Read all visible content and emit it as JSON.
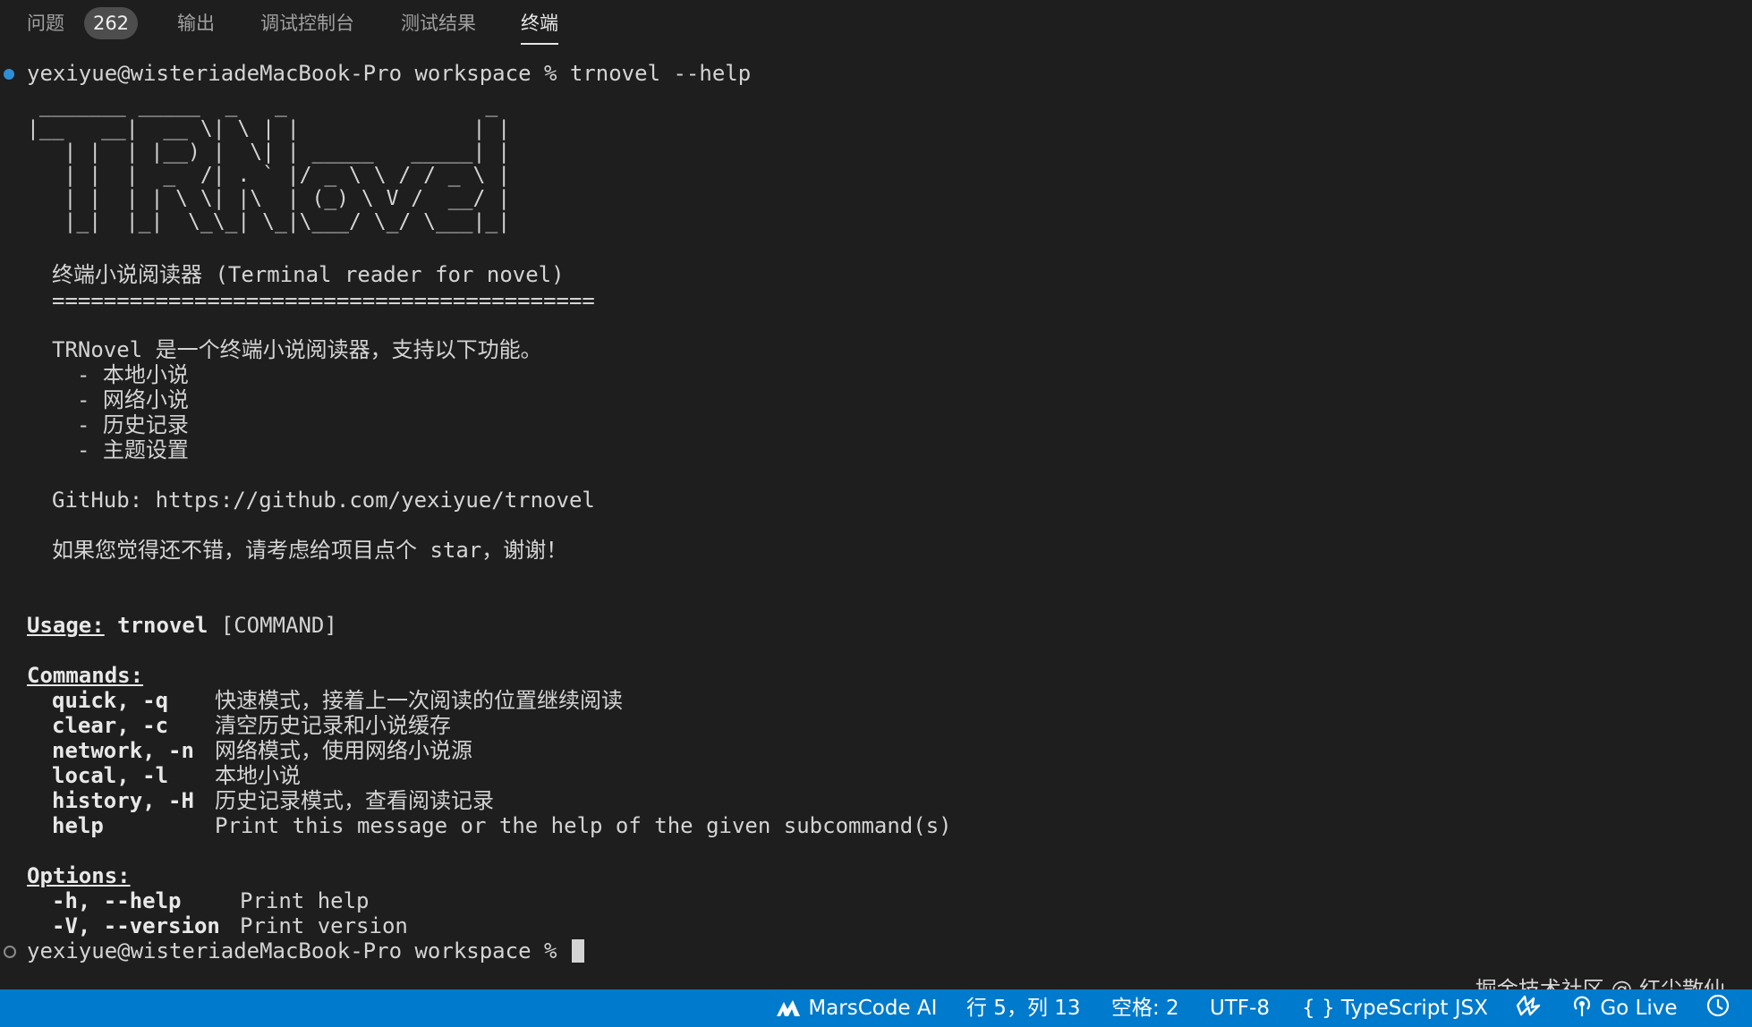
{
  "tabs": [
    {
      "label": "问题"
    },
    {
      "label": "输出"
    },
    {
      "label": "调试控制台"
    },
    {
      "label": "测试结果"
    },
    {
      "label": "终端"
    }
  ],
  "problems_count": "262",
  "terminal": {
    "prompt": "yexiyue@wisteriadeMacBook-Pro workspace % ",
    "command": "trnovel --help",
    "ascii_art": " _______ _____  _   _                _ \n|__   __|  __ \\| \\ | |              | |\n   | |  | |__) |  \\| | _____   _____| |\n   | |  |  _  /| . ` |/ _ \\ \\ / / _ \\ |\n   | |  | | \\ \\| |\\  | (_) \\ V /  __/ |\n   |_|  |_|  \\_\\_| \\_|\\___/ \\_/ \\___|_|",
    "subtitle": "终端小说阅读器 (Terminal reader for novel)",
    "separator": "==========================================",
    "intro": "TRNovel 是一个终端小说阅读器，支持以下功能。",
    "features": [
      "- 本地小说",
      "- 网络小说",
      "- 历史记录",
      "- 主题设置"
    ],
    "github": "GitHub: https://github.com/yexiyue/trnovel",
    "thanks": "如果您觉得还不错，请考虑给项目点个 star，谢谢！",
    "usage_label": "Usage:",
    "usage_bin": "trnovel",
    "usage_args": " [COMMAND]",
    "commands_label": "Commands:",
    "commands": [
      {
        "name": "quick, -q",
        "desc": "快速模式，接着上一次阅读的位置继续阅读"
      },
      {
        "name": "clear, -c",
        "desc": "清空历史记录和小说缓存"
      },
      {
        "name": "network, -n",
        "desc": "网络模式，使用网络小说源"
      },
      {
        "name": "local, -l",
        "desc": "本地小说"
      },
      {
        "name": "history, -H",
        "desc": "历史记录模式，查看阅读记录"
      },
      {
        "name": "help",
        "desc": "Print this message or the help of the given subcommand(s)"
      }
    ],
    "options_label": "Options:",
    "options": [
      {
        "name": "-h, --help",
        "desc": "Print help"
      },
      {
        "name": "-V, --version",
        "desc": "Print version"
      }
    ]
  },
  "watermark": "掘金技术社区 @ 红尘散仙",
  "statusbar": {
    "marscode": "MarsCode AI",
    "position": "行 5，列 13",
    "indent": "空格: 2",
    "encoding": "UTF-8",
    "language_icon": "{ }",
    "language": "TypeScript JSX",
    "golive": "Go Live"
  },
  "colors": {
    "background": "#1e1e1e",
    "statusbar": "#007acc",
    "prompt_dot": "#2f8fd6"
  }
}
